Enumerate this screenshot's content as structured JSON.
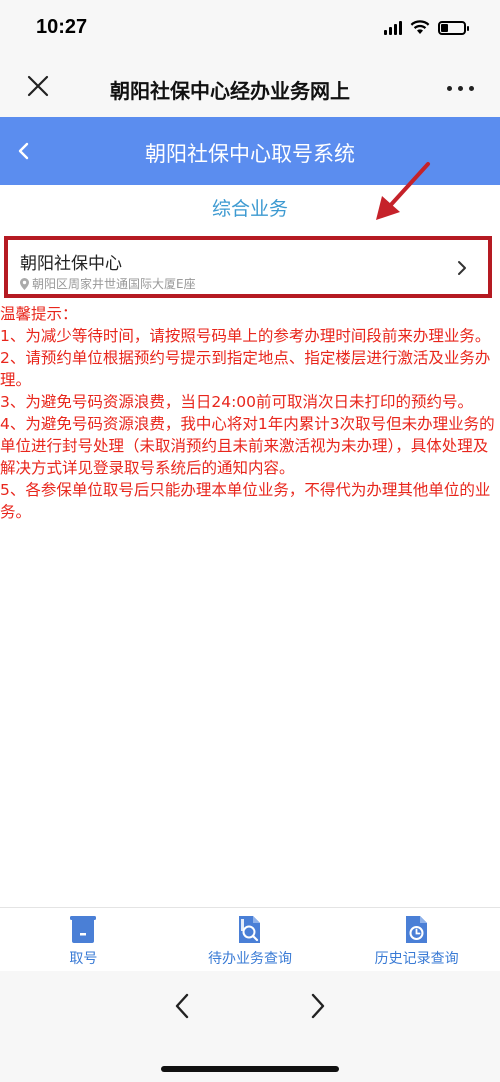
{
  "status_bar": {
    "time": "10:27",
    "battery_level": 0.3
  },
  "wechat_nav": {
    "title": "朝阳社保中心经办业务网上",
    "close_icon": "close-icon",
    "more_icon": "more-icon"
  },
  "app_header": {
    "title": "朝阳社保中心取号系统",
    "back_icon": "chevron-left-icon",
    "background": "#5b8def"
  },
  "section": {
    "title": "综合业务"
  },
  "center_card": {
    "name": "朝阳社保中心",
    "address": "朝阳区周家井世通国际大厦E座",
    "highlight_color": "#b51a22"
  },
  "notice": {
    "lines": [
      "温馨提示：",
      "1、为减少等待时间，请按照号码单上的参考办理时间段前来办理业务。",
      "2、请预约单位根据预约号提示到指定地点、指定楼层进行激活及业务办理。",
      "3、为避免号码资源浪费，当日24:00前可取消次日未打印的预约号。",
      "4、为避免号码资源浪费，我中心将对1年内累计3次取号但未办理业务的单位进行封号处理（未取消预约且未前来激活视为未办理），具体处理及解决方式详见登录取号系统后的通知内容。",
      "5、各参保单位取号后只能办理本单位业务，不得代为办理其他单位的业务。"
    ],
    "color": "#e8261c"
  },
  "tab_bar": {
    "tabs": [
      {
        "label": "取号",
        "icon": "ticket-icon"
      },
      {
        "label": "待办业务查询",
        "icon": "search-document-icon"
      },
      {
        "label": "历史记录查询",
        "icon": "history-document-icon"
      }
    ]
  },
  "browser_nav": {
    "back_icon": "chevron-left-icon",
    "forward_icon": "chevron-right-icon"
  }
}
